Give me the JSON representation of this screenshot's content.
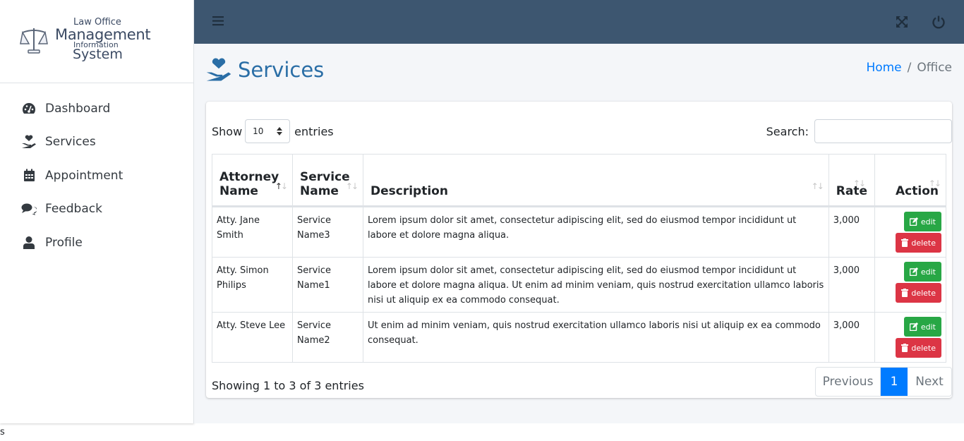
{
  "brand": {
    "line1": "Law Office",
    "line2": "Management",
    "line3": "Information",
    "line4": "System"
  },
  "sidebar": {
    "items": [
      {
        "label": "Dashboard",
        "icon": "tachometer-icon"
      },
      {
        "label": "Services",
        "icon": "hand-holding-heart-icon"
      },
      {
        "label": "Appointment",
        "icon": "calendar-icon"
      },
      {
        "label": "Feedback",
        "icon": "comments-icon"
      },
      {
        "label": "Profile",
        "icon": "user-icon"
      }
    ]
  },
  "topbar": {
    "menu_icon": "bars-icon",
    "fullscreen_icon": "expand-arrows-icon",
    "logout_icon": "power-off-icon"
  },
  "page": {
    "title": "Services",
    "breadcrumb": {
      "home": "Home",
      "separator": "/",
      "current": "Office"
    }
  },
  "table_controls": {
    "show_label": "Show",
    "entries_value": "10",
    "entries_label": "entries",
    "search_label": "Search:",
    "search_value": ""
  },
  "table": {
    "columns": [
      "Attorney Name",
      "Service Name",
      "Description",
      "Rate",
      "Action"
    ],
    "col_header_lines": {
      "attorney": [
        "Attorney",
        "Name"
      ],
      "service": [
        "Service",
        "Name"
      ]
    },
    "rows": [
      {
        "attorney": "Atty. Jane Smith",
        "service": "Service Name3",
        "description": "Lorem ipsum dolor sit amet, consectetur adipiscing elit, sed do eiusmod tempor incididunt ut labore et dolore magna aliqua.",
        "rate": "3,000"
      },
      {
        "attorney": "Atty. Simon Philips",
        "service": "Service Name1",
        "description": "Lorem ipsum dolor sit amet, consectetur adipiscing elit, sed do eiusmod tempor incididunt ut labore et dolore magna aliqua. Ut enim ad minim veniam, quis nostrud exercitation ullamco laboris nisi ut aliquip ex ea commodo consequat.",
        "rate": "3,000"
      },
      {
        "attorney": "Atty. Steve Lee",
        "service": "Service Name2",
        "description": "Ut enim ad minim veniam, quis nostrud exercitation ullamco laboris nisi ut aliquip ex ea commodo consequat.",
        "rate": "3,000"
      }
    ],
    "edit_label": "edit",
    "delete_label": "delete"
  },
  "footer": {
    "info": "Showing 1 to 3 of 3 entries",
    "pagination": {
      "previous": "Previous",
      "current": "1",
      "next": "Next"
    }
  },
  "stray_text": "s",
  "colors": {
    "topbar": "#3d5670",
    "title": "#2a6ea6",
    "link": "#007bff",
    "edit": "#28a745",
    "delete": "#dc3545"
  }
}
